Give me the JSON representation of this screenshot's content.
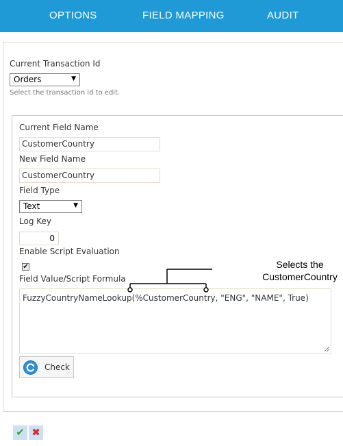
{
  "tabs": [
    {
      "label": "OPTIONS"
    },
    {
      "label": "FIELD MAPPING"
    },
    {
      "label": "AUDIT"
    }
  ],
  "transaction": {
    "label": "Current Transaction Id",
    "selected": "Orders",
    "hint": "Select the transaction id to edit."
  },
  "field": {
    "current_name_label": "Current Field Name",
    "current_name_value": "CustomerCountry",
    "new_name_label": "New Field Name",
    "new_name_value": "CustomerCountry",
    "type_label": "Field Type",
    "type_selected": "Text",
    "log_key_label": "Log Key",
    "log_key_value": "0",
    "enable_script_label": "Enable Script Evaluation",
    "enable_script_checked": true,
    "formula_label": "Field Value/Script Formula",
    "formula_value": "FuzzyCountryNameLookup(%CustomerCountry, \"ENG\", \"NAME\", True)",
    "check_button_label": "Check"
  },
  "callout": {
    "line1": "Selects the",
    "line2": "CustomerCountry"
  },
  "colors": {
    "tabbar": "#1f9ad6",
    "accept": "#2ea82e",
    "cancel": "#d42a2a"
  },
  "icons": {
    "check": "refresh-icon",
    "accept": "green-checkmark-icon",
    "cancel": "red-x-icon"
  }
}
